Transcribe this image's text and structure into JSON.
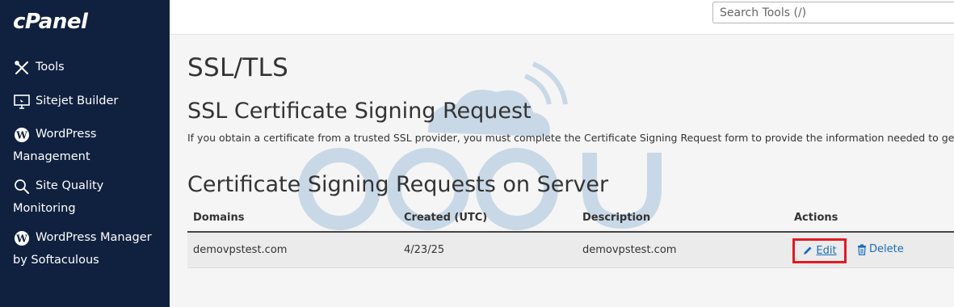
{
  "brand": {
    "logo": "cPanel"
  },
  "sidebar": {
    "items": [
      {
        "label": "Tools",
        "icon": "tools-icon"
      },
      {
        "label": "Sitejet Builder",
        "icon": "monitor-icon"
      },
      {
        "label": "WordPress Management",
        "icon": "wordpress-icon"
      },
      {
        "label": "Site Quality Monitoring",
        "icon": "magnifier-icon"
      },
      {
        "label": "WordPress Manager by Softaculous",
        "icon": "wordpress-icon"
      }
    ]
  },
  "topbar": {
    "search_placeholder": "Search Tools (/)"
  },
  "page": {
    "title": "SSL/TLS",
    "section_title": "SSL Certificate Signing Request",
    "section_desc": "If you obtain a certificate from a trusted SSL provider, you must complete the Certificate Signing Request form to provide the information needed to generate your",
    "section2_title": "Certificate Signing Requests on Server"
  },
  "table": {
    "headers": [
      "Domains",
      "Created (UTC)",
      "Description",
      "Actions"
    ],
    "rows": [
      {
        "domain": "demovpstest.com",
        "created": "4/23/25",
        "description": "demovpstest.com",
        "edit": "Edit",
        "delete": "Delete"
      }
    ]
  },
  "colors": {
    "sidebar": "#10213f",
    "link": "#1b6bb8",
    "highlight": "#e11b22"
  }
}
